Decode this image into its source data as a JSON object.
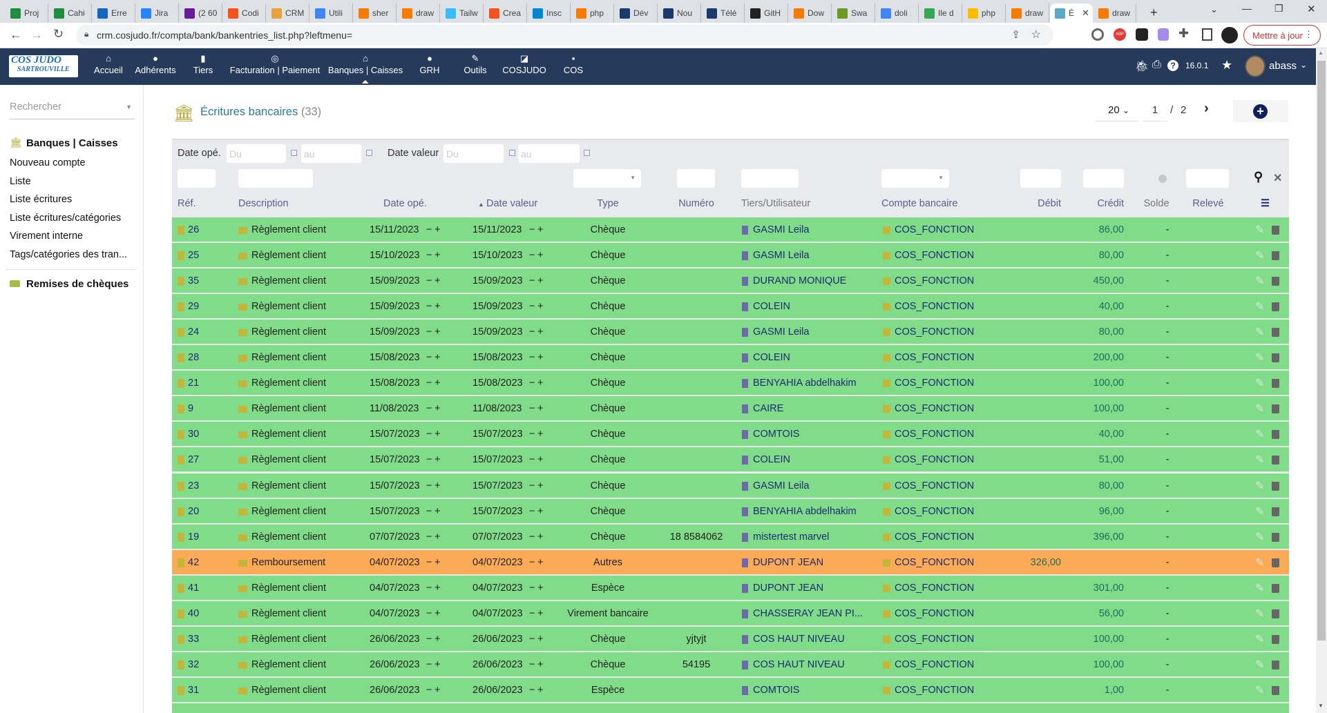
{
  "browser": {
    "tabs": [
      {
        "label": "Proj",
        "color": "#1e8e3e"
      },
      {
        "label": "Cahi",
        "color": "#1e8e3e"
      },
      {
        "label": "Erre",
        "color": "#1565c0"
      },
      {
        "label": "Jira",
        "color": "#2684ff"
      },
      {
        "label": "(2 60",
        "color": "#6a1b9a"
      },
      {
        "label": "Codi",
        "color": "#f4511e"
      },
      {
        "label": "CRM",
        "color": "#e9a23b"
      },
      {
        "label": "Utili",
        "color": "#4285f4"
      },
      {
        "label": "sher",
        "color": "#f57c00"
      },
      {
        "label": "draw",
        "color": "#f57c00"
      },
      {
        "label": "Tailw",
        "color": "#38bdf8"
      },
      {
        "label": "Crea",
        "color": "#f4511e"
      },
      {
        "label": "Insc",
        "color": "#0288d1"
      },
      {
        "label": "php",
        "color": "#f57c00"
      },
      {
        "label": "Dév",
        "color": "#1a3a6b"
      },
      {
        "label": "Nou",
        "color": "#1a3a6b"
      },
      {
        "label": "Télé",
        "color": "#1a3a6b"
      },
      {
        "label": "GitH",
        "color": "#222222"
      },
      {
        "label": "Dow",
        "color": "#f57c00"
      },
      {
        "label": "Swa",
        "color": "#6a9a1f"
      },
      {
        "label": "doli",
        "color": "#4285f4"
      },
      {
        "label": "Ile d",
        "color": "#34a853"
      },
      {
        "label": "php",
        "color": "#fbbc04"
      },
      {
        "label": "draw",
        "color": "#f57c00"
      },
      {
        "label": "É",
        "color": "#5aa8c8",
        "active": true
      },
      {
        "label": "draw",
        "color": "#f57c00"
      }
    ],
    "url": "crm.cosjudo.fr/compta/bank/bankentries_list.php?leftmenu=",
    "update_button": "Mettre à jour"
  },
  "nav": {
    "logo_top": "COS JUDO",
    "logo_bottom": "SARTROUVILLE",
    "items": [
      {
        "label": "Accueil",
        "icon": "home-icon",
        "glyph": "⌂"
      },
      {
        "label": "Adhérents",
        "icon": "user-icon",
        "glyph": "●"
      },
      {
        "label": "Tiers",
        "icon": "building-icon",
        "glyph": "▮"
      },
      {
        "label": "Facturation | Paiement",
        "icon": "coins-icon",
        "glyph": "◎"
      },
      {
        "label": "Banques | Caisses",
        "icon": "bank-icon",
        "glyph": "⌂"
      },
      {
        "label": "GRH",
        "icon": "user-tie-icon",
        "glyph": "●"
      },
      {
        "label": "Outils",
        "icon": "wrench-icon",
        "glyph": "✎"
      },
      {
        "label": "COSJUDO",
        "icon": "external-icon",
        "glyph": "◪"
      },
      {
        "label": "COS",
        "icon": "note-icon",
        "glyph": "▪"
      }
    ],
    "active_index": 4,
    "version": "16.0.1",
    "user": "abass"
  },
  "sidebar": {
    "search_placeholder": "Rechercher",
    "section1": "Banques | Caisses",
    "items": [
      "Nouveau compte",
      "Liste",
      "Liste écritures",
      "Liste écritures/catégories",
      "Virement interne",
      "Tags/catégories des tran..."
    ],
    "section2": "Remises de chèques"
  },
  "main": {
    "title": "Écritures bancaires",
    "count": "(33)",
    "page_size": "20",
    "page": "1",
    "page_sep": "/",
    "pages": "2",
    "filters": {
      "date_ope_label": "Date opé.",
      "date_valeur_label": "Date valeur",
      "from_placeholder": "Du",
      "to_placeholder": "au"
    },
    "columns": [
      "Réf.",
      "Description",
      "Date opé.",
      "Date valeur",
      "Type",
      "Numéro",
      "Tiers/Utilisateur",
      "Compte bancaire",
      "Débit",
      "Crédit",
      "Solde",
      "Relevé"
    ],
    "sort_indicator": "▲",
    "date_minus": "−",
    "date_plus": "+",
    "rows": [
      {
        "ref": "26",
        "desc": "Règlement client",
        "date_ope": "15/11/2023",
        "date_val": "15/11/2023",
        "type": "Chèque",
        "num": "",
        "tiers": "GASMI Leila",
        "account": "COS_FONCTION",
        "debit": "",
        "credit": "86,00",
        "solde": "-"
      },
      {
        "ref": "25",
        "desc": "Règlement client",
        "date_ope": "15/10/2023",
        "date_val": "15/10/2023",
        "type": "Chèque",
        "num": "",
        "tiers": "GASMI Leila",
        "account": "COS_FONCTION",
        "debit": "",
        "credit": "80,00",
        "solde": "-"
      },
      {
        "ref": "35",
        "desc": "Règlement client",
        "date_ope": "15/09/2023",
        "date_val": "15/09/2023",
        "type": "Chèque",
        "num": "",
        "tiers": "DURAND MONIQUE",
        "account": "COS_FONCTION",
        "debit": "",
        "credit": "450,00",
        "solde": "-"
      },
      {
        "ref": "29",
        "desc": "Règlement client",
        "date_ope": "15/09/2023",
        "date_val": "15/09/2023",
        "type": "Chèque",
        "num": "",
        "tiers": "COLEIN",
        "account": "COS_FONCTION",
        "debit": "",
        "credit": "40,00",
        "solde": "-"
      },
      {
        "ref": "24",
        "desc": "Règlement client",
        "date_ope": "15/09/2023",
        "date_val": "15/09/2023",
        "type": "Chèque",
        "num": "",
        "tiers": "GASMI Leila",
        "account": "COS_FONCTION",
        "debit": "",
        "credit": "80,00",
        "solde": "-"
      },
      {
        "ref": "28",
        "desc": "Règlement client",
        "date_ope": "15/08/2023",
        "date_val": "15/08/2023",
        "type": "Chèque",
        "num": "",
        "tiers": "COLEIN",
        "account": "COS_FONCTION",
        "debit": "",
        "credit": "200,00",
        "solde": "-"
      },
      {
        "ref": "21",
        "desc": "Règlement client",
        "date_ope": "15/08/2023",
        "date_val": "15/08/2023",
        "type": "Chèque",
        "num": "",
        "tiers": "BENYAHIA abdelhakim",
        "account": "COS_FONCTION",
        "debit": "",
        "credit": "100,00",
        "solde": "-"
      },
      {
        "ref": "9",
        "desc": "Règlement client",
        "date_ope": "11/08/2023",
        "date_val": "11/08/2023",
        "type": "Chèque",
        "num": "",
        "tiers": "CAIRE",
        "account": "COS_FONCTION",
        "debit": "",
        "credit": "100,00",
        "solde": "-"
      },
      {
        "ref": "30",
        "desc": "Règlement client",
        "date_ope": "15/07/2023",
        "date_val": "15/07/2023",
        "type": "Chèque",
        "num": "",
        "tiers": "COMTOIS",
        "account": "COS_FONCTION",
        "debit": "",
        "credit": "40,00",
        "solde": "-"
      },
      {
        "ref": "27",
        "desc": "Règlement client",
        "date_ope": "15/07/2023",
        "date_val": "15/07/2023",
        "type": "Chèque",
        "num": "",
        "tiers": "COLEIN",
        "account": "COS_FONCTION",
        "debit": "",
        "credit": "51,00",
        "solde": "-"
      },
      {
        "ref": "23",
        "desc": "Règlement client",
        "date_ope": "15/07/2023",
        "date_val": "15/07/2023",
        "type": "Chèque",
        "num": "",
        "tiers": "GASMI Leila",
        "account": "COS_FONCTION",
        "debit": "",
        "credit": "80,00",
        "solde": "-"
      },
      {
        "ref": "20",
        "desc": "Règlement client",
        "date_ope": "15/07/2023",
        "date_val": "15/07/2023",
        "type": "Chèque",
        "num": "",
        "tiers": "BENYAHIA abdelhakim",
        "account": "COS_FONCTION",
        "debit": "",
        "credit": "96,00",
        "solde": "-"
      },
      {
        "ref": "19",
        "desc": "Règlement client",
        "date_ope": "07/07/2023",
        "date_val": "07/07/2023",
        "type": "Chèque",
        "num": "18 8584062",
        "tiers": "mistertest marvel",
        "account": "COS_FONCTION",
        "debit": "",
        "credit": "396,00",
        "solde": "-"
      },
      {
        "ref": "42",
        "desc": "Remboursement",
        "date_ope": "04/07/2023",
        "date_val": "04/07/2023",
        "type": "Autres",
        "num": "",
        "tiers": "DUPONT JEAN",
        "account": "COS_FONCTION",
        "debit": "326,00",
        "credit": "",
        "solde": "-",
        "highlight": true
      },
      {
        "ref": "41",
        "desc": "Règlement client",
        "date_ope": "04/07/2023",
        "date_val": "04/07/2023",
        "type": "Espèce",
        "num": "",
        "tiers": "DUPONT JEAN",
        "account": "COS_FONCTION",
        "debit": "",
        "credit": "301,00",
        "solde": "-"
      },
      {
        "ref": "40",
        "desc": "Règlement client",
        "date_ope": "04/07/2023",
        "date_val": "04/07/2023",
        "type": "Virement bancaire",
        "num": "",
        "tiers": "CHASSERAY JEAN PI...",
        "account": "COS_FONCTION",
        "debit": "",
        "credit": "56,00",
        "solde": "-"
      },
      {
        "ref": "33",
        "desc": "Règlement client",
        "date_ope": "26/06/2023",
        "date_val": "26/06/2023",
        "type": "Chèque",
        "num": "yjtyjt",
        "tiers": "COS HAUT NIVEAU",
        "account": "COS_FONCTION",
        "debit": "",
        "credit": "100,00",
        "solde": "-"
      },
      {
        "ref": "32",
        "desc": "Règlement client",
        "date_ope": "26/06/2023",
        "date_val": "26/06/2023",
        "type": "Chèque",
        "num": "54195",
        "tiers": "COS HAUT NIVEAU",
        "account": "COS_FONCTION",
        "debit": "",
        "credit": "100,00",
        "solde": "-"
      },
      {
        "ref": "31",
        "desc": "Règlement client",
        "date_ope": "26/06/2023",
        "date_val": "26/06/2023",
        "type": "Espèce",
        "num": "",
        "tiers": "COMTOIS",
        "account": "COS_FONCTION",
        "debit": "",
        "credit": "1,00",
        "solde": "-"
      }
    ]
  },
  "colors": {
    "nav": "#263b5b",
    "row_green": "#80dc88",
    "row_orange": "#fbaa55",
    "title": "#2a7b9b",
    "credit": "#1d6d5c"
  }
}
